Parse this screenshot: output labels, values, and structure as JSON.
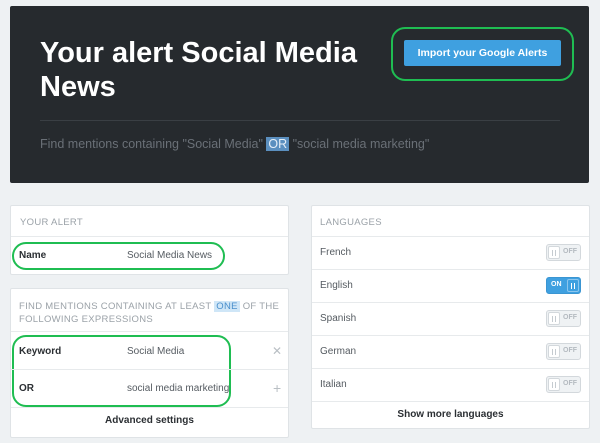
{
  "header": {
    "title": "Your alert Social Media News",
    "import_label": "Import your Google Alerts",
    "summary_prefix": "Find mentions containing \"Social Media\" ",
    "summary_or": "OR",
    "summary_suffix": " \"social media marketing\""
  },
  "alert_panel": {
    "heading": "YOUR ALERT",
    "name_label": "Name",
    "name_value": "Social Media News"
  },
  "mentions_panel": {
    "heading_prefix": "FIND MENTIONS CONTAINING AT LEAST ",
    "heading_highlight": "ONE",
    "heading_suffix": " OF THE FOLLOWING EXPRESSIONS",
    "rows": [
      {
        "label": "Keyword",
        "value": "Social Media",
        "icon": "close-icon",
        "glyph": "✕"
      },
      {
        "label": "OR",
        "value": "social media marketing",
        "icon": "plus-icon",
        "glyph": "+"
      }
    ],
    "advanced_label": "Advanced settings"
  },
  "languages_panel": {
    "heading": "LANGUAGES",
    "on_label": "ON",
    "off_label": "OFF",
    "items": [
      {
        "name": "French",
        "enabled": false
      },
      {
        "name": "English",
        "enabled": true
      },
      {
        "name": "Spanish",
        "enabled": false
      },
      {
        "name": "German",
        "enabled": false
      },
      {
        "name": "Italian",
        "enabled": false
      }
    ],
    "more_label": "Show more languages"
  },
  "colors": {
    "header_bg": "#262a2e",
    "accent_blue": "#3fa0e0",
    "highlight_ring": "#1fbd52"
  }
}
